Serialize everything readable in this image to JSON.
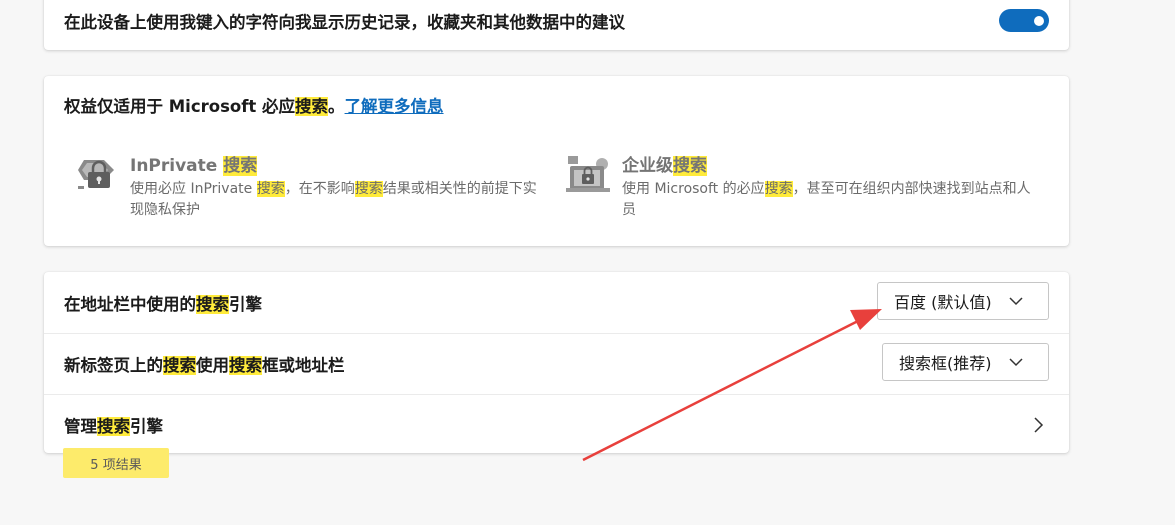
{
  "history_setting": {
    "text": "在此设备上使用我键入的字符向我显示历史记录，收藏夹和其他数据中的建议",
    "toggle_on": true
  },
  "benefits": {
    "title_prefix": "权益仅适用于 Microsoft 必应",
    "title_hl": "搜索",
    "title_suffix": "。",
    "learn_more": "了解更多信息",
    "inprivate": {
      "title_plain": "InPrivate ",
      "title_hl": "搜索",
      "desc_1": "使用必应 InPrivate ",
      "desc_hl1": "搜索",
      "desc_2": "，在不影响",
      "desc_hl2": "搜索",
      "desc_3": "结果或相关性的前提下实现隐私保护"
    },
    "enterprise": {
      "title_plain": "企业级",
      "title_hl": "搜索",
      "desc_1": "使用 Microsoft 的必应",
      "desc_hl1": "搜索",
      "desc_2": "，甚至可在组织内部快速找到站点和人员"
    }
  },
  "search_settings": {
    "address_bar": {
      "label_1": "在地址栏中使用的",
      "label_hl": "搜索",
      "label_2": "引擎",
      "value": "百度 (默认值)"
    },
    "new_tab": {
      "label_1": "新标签页上的",
      "label_hl1": "搜索",
      "label_2": "使用",
      "label_hl2": "搜索",
      "label_3": "框或地址栏",
      "value": "搜索框(推荐)"
    },
    "manage": {
      "label_1": "管理",
      "label_hl": "搜索",
      "label_2": "引擎"
    },
    "results_badge": "5 项结果"
  },
  "colors": {
    "accent": "#0f6cbd",
    "highlight": "#ffeb3b",
    "arrow": "#e8403c"
  },
  "icons": {
    "inprivate": "inprivate-search-icon",
    "enterprise": "enterprise-search-icon",
    "chevron": "chevron-down-icon",
    "chevron_right": "chevron-right-icon"
  }
}
